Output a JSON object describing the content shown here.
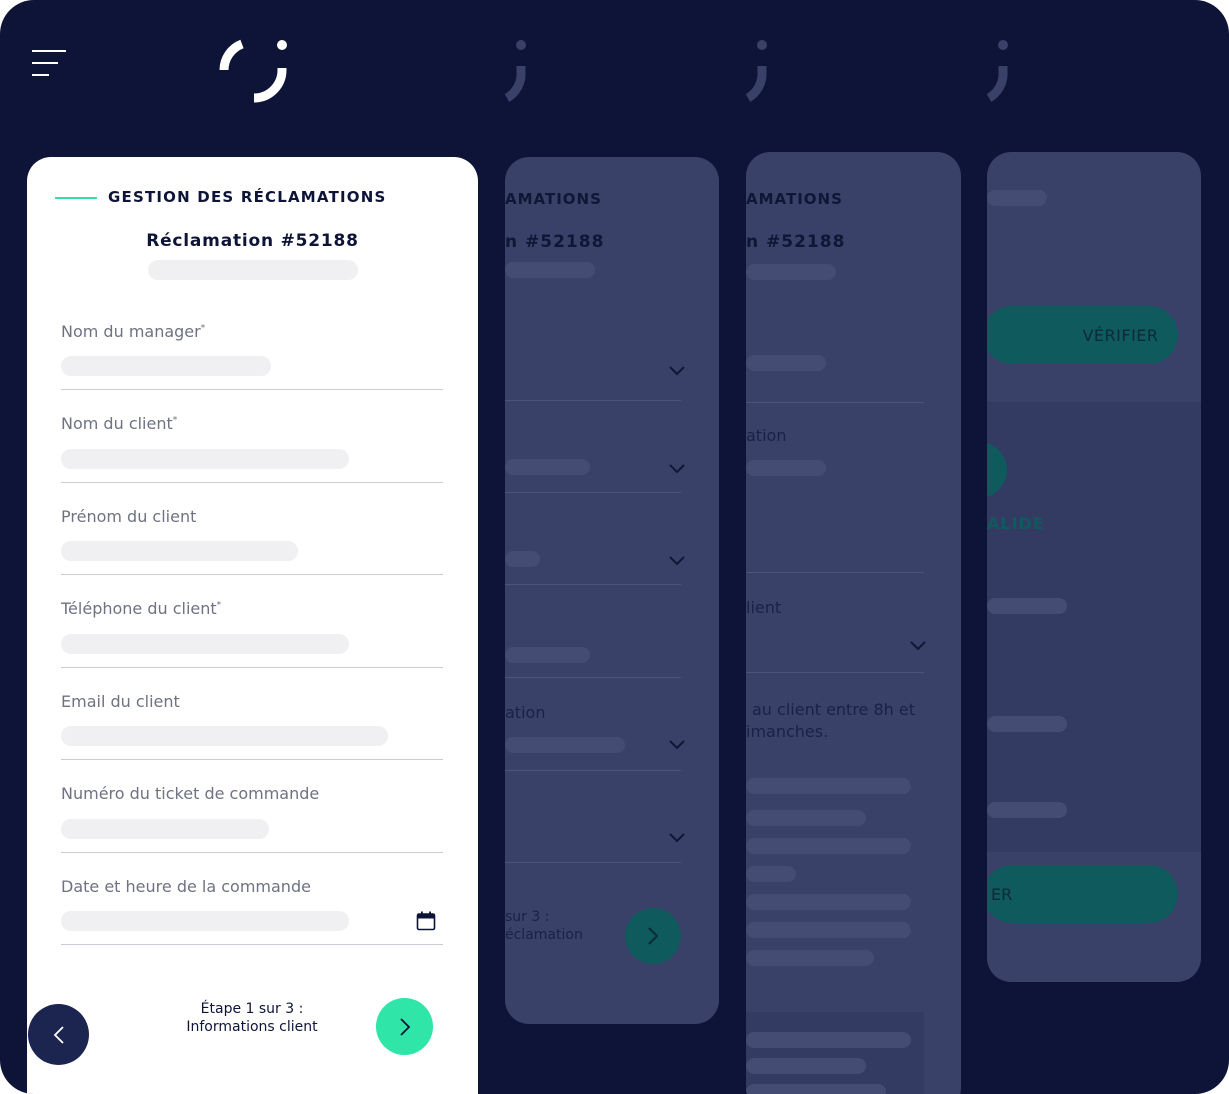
{
  "header": {
    "menu_icon": "hamburger-icon",
    "logo_icon": "g-logo-icon"
  },
  "card": {
    "section_title": "GESTION DES RÉCLAMATIONS",
    "reclamation_title": "Réclamation #52188",
    "fields": [
      {
        "label": "Nom du manager",
        "required": "*"
      },
      {
        "label": "Nom du client",
        "required": "*"
      },
      {
        "label": "Prénom du client",
        "required": ""
      },
      {
        "label": "Téléphone du client",
        "required": "*"
      },
      {
        "label": "Email du client",
        "required": ""
      },
      {
        "label": "Numéro du ticket de commande",
        "required": ""
      },
      {
        "label": "Date et heure de la commande",
        "required": ""
      }
    ],
    "step_line1": "Étape 1 sur 3 :",
    "step_line2": "Informations client"
  },
  "panel2": {
    "section_title": "AMATIONS",
    "reclamation_title": "n #52188",
    "field_label": "ation",
    "step_line1": "sur 3 :",
    "step_line2": "éclamation"
  },
  "panel3": {
    "section_title": "AMATIONS",
    "reclamation_title": "n #52188",
    "label_a": "ation",
    "label_b": "lient",
    "info_line1": "au client entre 8h et",
    "info_line2": "imanches."
  },
  "panel4": {
    "verify_button": "VÉRIFIER",
    "status_text": "ALIDE",
    "bottom_button": "ER"
  },
  "colors": {
    "navy": "#0d1438",
    "accent": "#2fe5a8",
    "teal_dark": "#0f5a5c"
  }
}
